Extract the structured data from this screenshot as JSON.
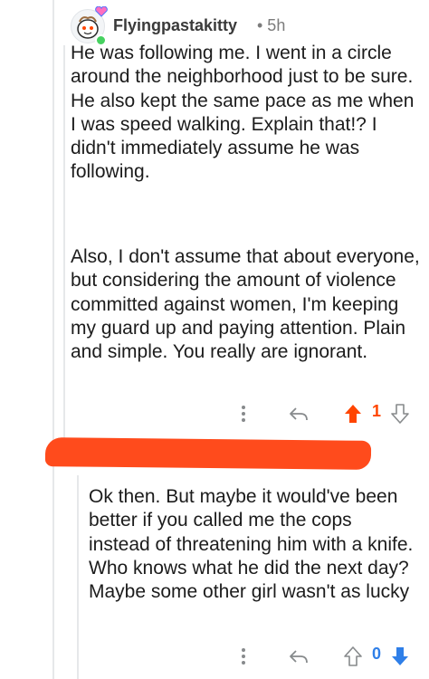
{
  "comment": {
    "username": "Flyingpastakitty",
    "time": "• 5h",
    "paragraphs": [
      "He was following me. I went in a circle around the neighborhood just to be sure. He also kept the same pace as me when I was speed walking. Explain that!? I didn't immediately assume he was following.",
      "Also, I don't assume that about everyone, but considering the amount of violence committed against women, I'm keeping my guard up and paying attention. Plain and simple. You really are ignorant."
    ],
    "score": "1",
    "vote_state": "upvoted",
    "upvote_color": "#ff4500"
  },
  "reply": {
    "author_redacted": true,
    "redaction_color": "#ff4b1c",
    "text": "Ok then. But maybe it would've been better if you called me the cops instead of threatening him with a knife. Who knows what he did the next day? Maybe some other girl wasn't as lucky",
    "score": "0",
    "downvote_color": "#2f7fe8"
  },
  "icons": {
    "more": "more-vertical-icon",
    "reply": "reply-arrow-icon",
    "upvote": "upvote-arrow-icon",
    "downvote": "downvote-arrow-icon"
  }
}
